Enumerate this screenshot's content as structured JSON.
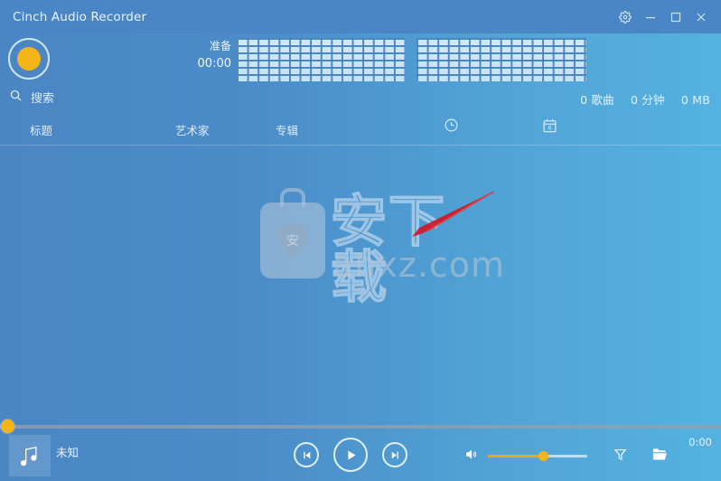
{
  "window": {
    "title": "Cinch Audio Recorder",
    "controls": [
      {
        "name": "settings-button",
        "icon": "gear-icon"
      },
      {
        "name": "minimize-button",
        "icon": "minimize-icon"
      },
      {
        "name": "maximize-button",
        "icon": "maximize-icon"
      },
      {
        "name": "close-button",
        "icon": "close-icon"
      }
    ]
  },
  "recorder": {
    "record_button": "record-button",
    "status_label": "准备",
    "elapsed_time": "00:00",
    "meters": [
      "meter-left",
      "meter-right"
    ]
  },
  "search": {
    "icon": "search-icon",
    "placeholder": "搜索",
    "value": ""
  },
  "library_stats": {
    "songs": "0 歌曲",
    "duration": "0 分钟",
    "size": "0 MB"
  },
  "columns": {
    "title": "标题",
    "artist": "艺术家",
    "album": "专辑",
    "time_icon": "clock-icon",
    "date_icon": "calendar-icon",
    "calendar_day": "6"
  },
  "track_list": {
    "rows": [],
    "empty": true
  },
  "watermark": {
    "logo_char": "安",
    "text_cn": "安下载",
    "domain": "anxz.com"
  },
  "player": {
    "art_icon": "music-note-icon",
    "track_title": "未知",
    "progress_percent": 0,
    "current_time": "0:00",
    "previous_button": "previous-icon",
    "play_button": "play-icon",
    "next_button": "next-icon",
    "volume_icon": "volume-icon",
    "volume_percent": 55,
    "filter_icon": "filter-icon",
    "folder_icon": "folder-icon"
  },
  "colors": {
    "accent": "#f5b519",
    "bg_left": "#4b86c4",
    "bg_right": "#55b2e0",
    "text": "#eaf4fc"
  }
}
